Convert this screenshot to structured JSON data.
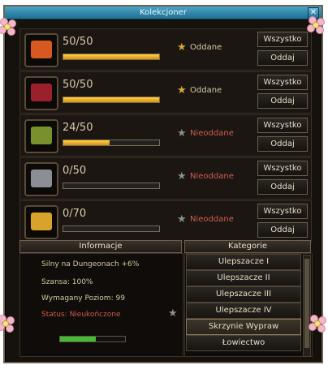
{
  "window": {
    "title": "Kolekcjoner",
    "close": "✕"
  },
  "rows": [
    {
      "count": "50/50",
      "progress": 1.0,
      "status": "Oddane",
      "star_color": "#d9a93a",
      "status_color": "#d6c8a6",
      "all_label": "Wszystko",
      "give_label": "Oddaj",
      "gem_color": "#d8591f",
      "gem_name": "chest-icon"
    },
    {
      "count": "50/50",
      "progress": 1.0,
      "status": "Oddane",
      "star_color": "#d9a93a",
      "status_color": "#d6c8a6",
      "all_label": "Wszystko",
      "give_label": "Oddaj",
      "gem_color": "#9c1f2c",
      "gem_name": "ruby-box-icon"
    },
    {
      "count": "24/50",
      "progress": 0.48,
      "status": "Nieoddane",
      "star_color": "#8d8d8d",
      "status_color": "#d25b52",
      "all_label": "Wszystko",
      "give_label": "Oddaj",
      "gem_color": "#76912d",
      "gem_name": "green-chest-icon"
    },
    {
      "count": "0/50",
      "progress": 0.0,
      "status": "Nieoddane",
      "star_color": "#8d8d8d",
      "status_color": "#d25b52",
      "all_label": "Wszystko",
      "give_label": "Oddaj",
      "gem_color": "#8b8f95",
      "gem_name": "silver-chest-icon"
    },
    {
      "count": "0/70",
      "progress": 0.0,
      "status": "Nieoddane",
      "star_color": "#8d8d8d",
      "status_color": "#d25b52",
      "all_label": "Wszystko",
      "give_label": "Oddaj",
      "gem_color": "#d8a32a",
      "gem_name": "gold-nugget-icon"
    }
  ],
  "info": {
    "header": "Informacje",
    "line1": "Silny na Dungeonach +6%",
    "line2": "Szansa: 100%",
    "line3": "Wymagany Poziom: 99",
    "line4": "Status: Nieukończone",
    "line4_color": "#cf5b54",
    "progress": 0.55
  },
  "categories": {
    "header": "Kategorie",
    "items": [
      "Ulepszacze I",
      "Ulepszacze II",
      "Ulepszacze III",
      "Ulepszacze IV",
      "Skrzynie Wypraw",
      "Łowiectwo"
    ],
    "active_index": 4
  }
}
